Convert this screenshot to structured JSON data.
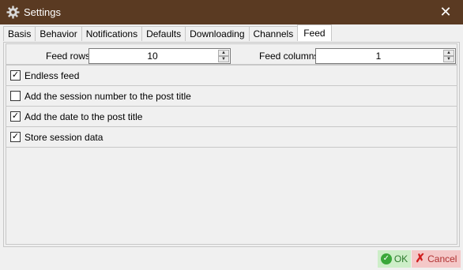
{
  "window": {
    "title": "Settings",
    "close_glyph": "✕",
    "icon": "gear-icon"
  },
  "tabs": [
    {
      "label": "Basis"
    },
    {
      "label": "Behavior"
    },
    {
      "label": "Notifications"
    },
    {
      "label": "Defaults"
    },
    {
      "label": "Downloading"
    },
    {
      "label": "Channels"
    },
    {
      "label": "Feed",
      "active": true
    }
  ],
  "feed": {
    "rows_label": "Feed rows",
    "rows_value": "10",
    "columns_label": "Feed columns",
    "columns_value": "1",
    "options": [
      {
        "label": "Endless feed",
        "checked": true
      },
      {
        "label": "Add the session number to the post title",
        "checked": false
      },
      {
        "label": "Add the date to the post title",
        "checked": true
      },
      {
        "label": "Store session data",
        "checked": true
      }
    ]
  },
  "footer": {
    "ok_label": "OK",
    "cancel_label": "Cancel"
  },
  "colors": {
    "titlebar": "#5a3a22",
    "ok_bg": "#cdeec8",
    "cancel_bg": "#f4c8c8"
  }
}
